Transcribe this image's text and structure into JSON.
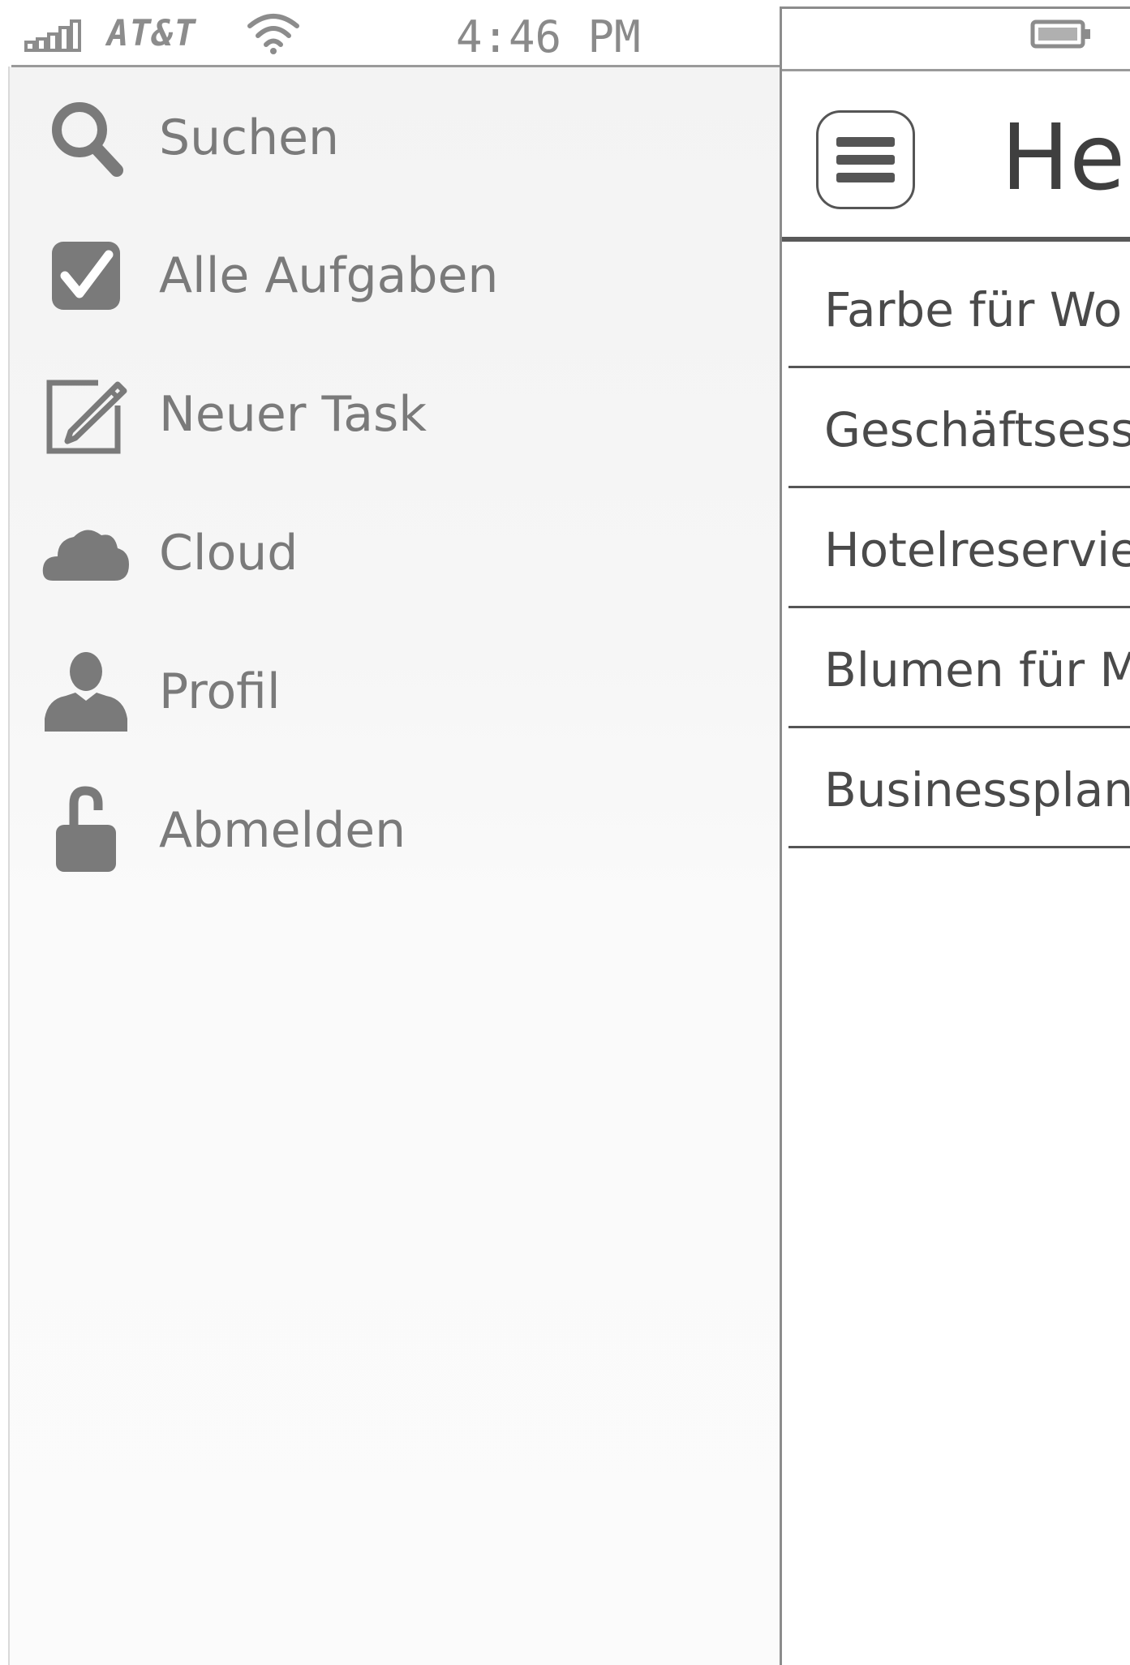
{
  "status_bar": {
    "carrier": "AT&T",
    "time": "4:46 PM",
    "signal_icon": "signal-bars-icon",
    "wifi_icon": "wifi-icon",
    "battery_icon": "battery-icon"
  },
  "menu": {
    "items": [
      {
        "label": "Suchen",
        "icon": "search-icon"
      },
      {
        "label": "Alle Aufgaben",
        "icon": "checkbox-checked-icon"
      },
      {
        "label": "Neuer Task",
        "icon": "edit-icon"
      },
      {
        "label": "Cloud",
        "icon": "cloud-icon"
      },
      {
        "label": "Profil",
        "icon": "user-icon"
      },
      {
        "label": "Abmelden",
        "icon": "unlock-icon"
      }
    ]
  },
  "main": {
    "title": "Heu",
    "menu_button_icon": "hamburger-menu-icon",
    "tasks": [
      "Farbe für Wo",
      "Geschäftsess",
      "Hotelreservie",
      "Blumen für M",
      "Businessplan-"
    ]
  },
  "colors": {
    "drawer_background": "#f3f3f3",
    "text_muted": "#7a7a7a",
    "text_dark": "#4a4a4a",
    "divider": "#555555"
  }
}
